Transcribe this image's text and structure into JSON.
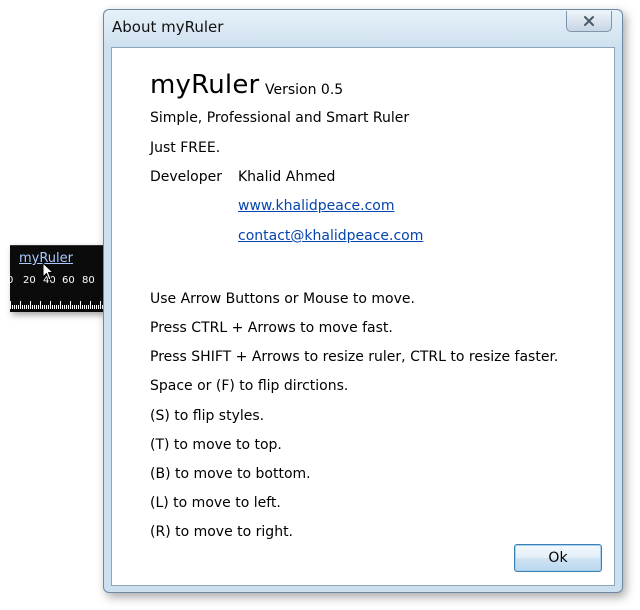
{
  "ruler": {
    "title": "myRuler",
    "labels": [
      "0",
      "20",
      "40",
      "60",
      "80"
    ]
  },
  "dialog": {
    "title": "About myRuler",
    "app_name": "myRuler",
    "version": "Version 0.5",
    "tagline": "Simple, Professional and Smart Ruler",
    "price": "Just FREE.",
    "developer_label": "Developer",
    "developer_name": "Khalid Ahmed",
    "website": "www.khalidpeace.com",
    "email": "contact@khalidpeace.com",
    "instructions": [
      "Use Arrow Buttons or Mouse to move.",
      "Press CTRL + Arrows to move fast.",
      "Press SHIFT + Arrows to resize ruler, CTRL to resize faster.",
      "Space or (F) to flip dirctions.",
      "(S) to flip styles.",
      "(T) to move to top.",
      "(B) to move to bottom.",
      "(L) to move to left.",
      "(R) to move to right."
    ],
    "ok_label": "Ok"
  }
}
